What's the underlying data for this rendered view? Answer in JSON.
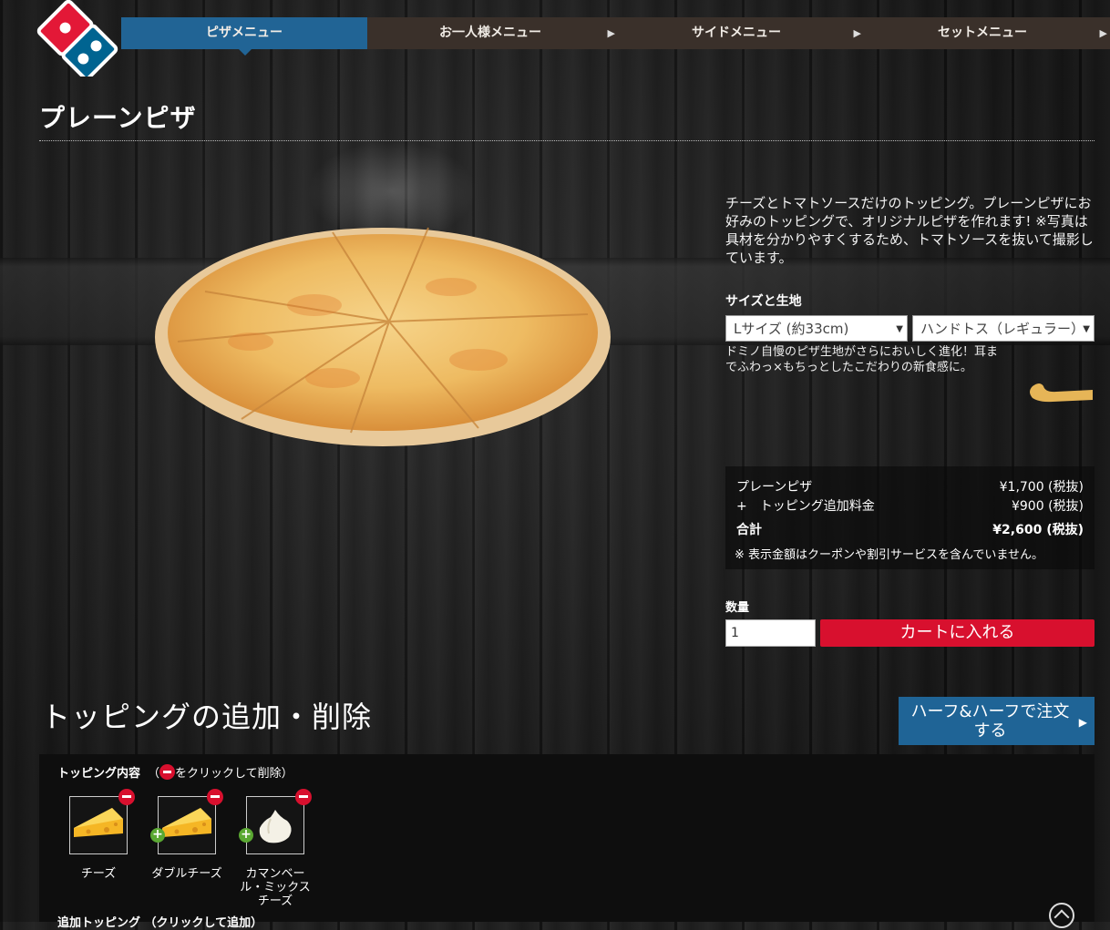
{
  "nav": {
    "items": [
      {
        "label": "ピザメニュー"
      },
      {
        "label": "お一人様メニュー"
      },
      {
        "label": "サイドメニュー"
      },
      {
        "label": "セットメニュー"
      }
    ]
  },
  "product": {
    "title": "プレーンピザ",
    "description": "チーズとトマトソースだけのトッピング。プレーンピザにお好みのトッピングで、オリジナルピザを作れます! ※写真は具材を分かりやすくするため、トマトソースを抜いて撮影しています。",
    "size_label": "サイズと生地",
    "size_select": "Lサイズ (約33cm)",
    "crust_select": "ハンドトス（レギュラー）",
    "dough_text": "ドミノ自慢のピザ生地がさらにおいしく進化！耳までふわっ×もちっとしたこだわりの新食感に。"
  },
  "price": {
    "item_name": "プレーンピザ",
    "item_price": "¥1,700 (税抜)",
    "topping_label": "+　トッピング追加料金",
    "topping_price": "¥900 (税抜)",
    "total_label": "合計",
    "total_price": "¥2,600 (税抜)",
    "note": "※ 表示金額はクーポンや割引サービスを含んでいません。"
  },
  "order": {
    "qty_label": "数量",
    "qty_value": "1",
    "cart_button": "カートに入れる"
  },
  "toppings": {
    "heading": "トッピングの追加・削除",
    "half_button": "ハーフ&ハーフで注文する",
    "contents_label": "トッピング内容",
    "contents_hint_pre": "（",
    "contents_hint_post": "をクリックして削除）",
    "items": [
      {
        "label": "チーズ"
      },
      {
        "label": "ダブルチーズ"
      },
      {
        "label": "カマンベール・ミックスチーズ"
      }
    ],
    "add_label": "追加トッピング （クリックして追加）"
  },
  "colors": {
    "nav_active": "#216495",
    "cart_red": "#d8102e",
    "half_blue": "#1f6496"
  }
}
